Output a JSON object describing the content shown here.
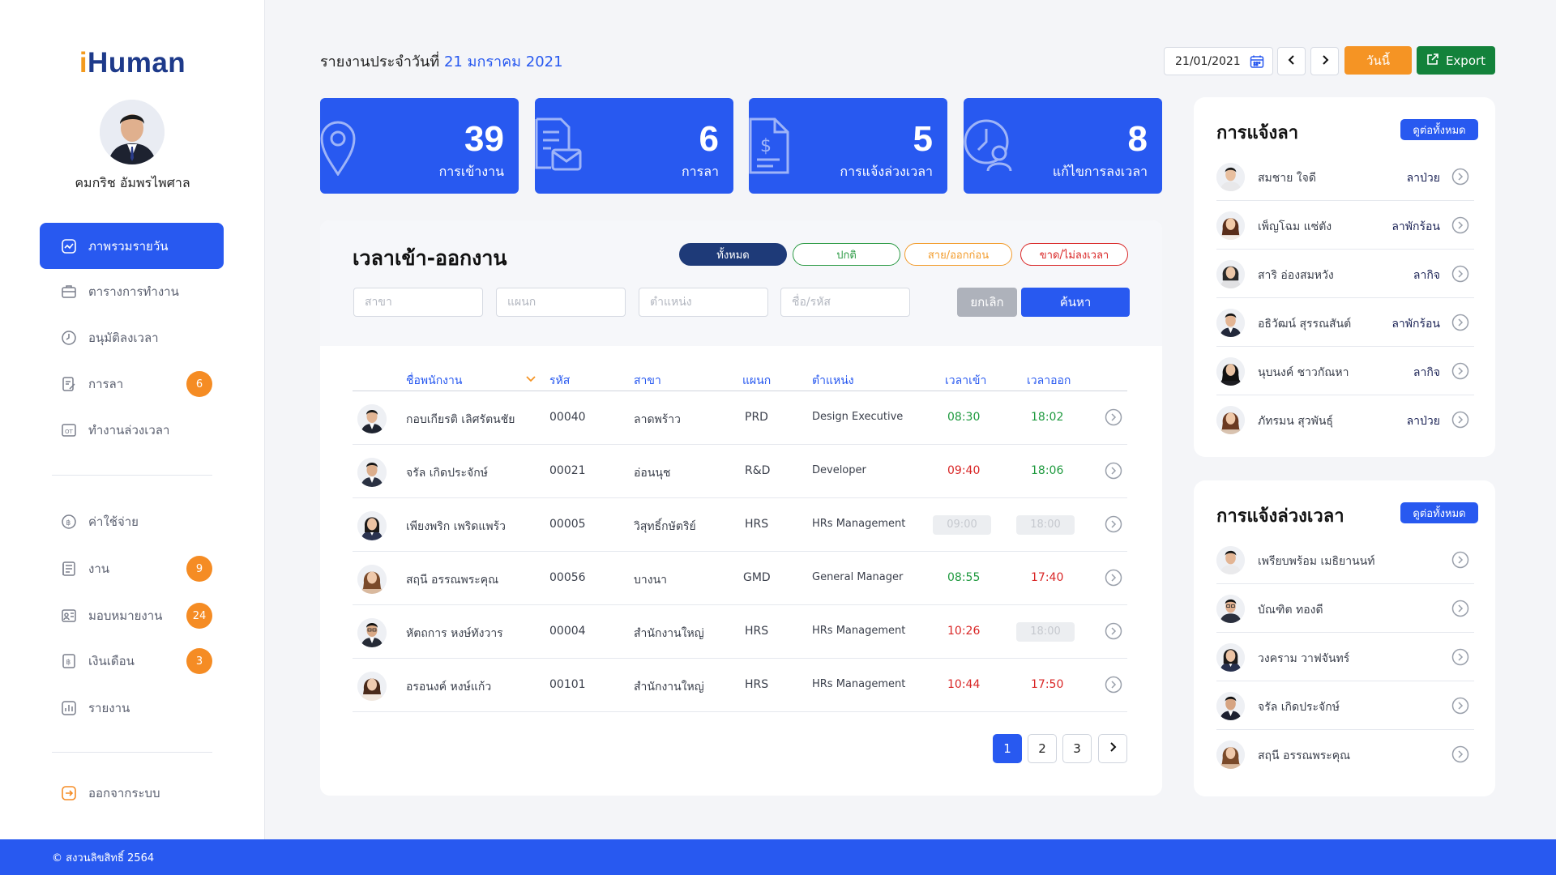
{
  "app": {
    "logo_prefix": "i",
    "logo_rest": "Human"
  },
  "user": {
    "name": "คมกริช อัมพรไพศาล"
  },
  "sidebar": {
    "items": [
      {
        "label": "ภาพรวมรายวัน",
        "icon": "chart-line-icon",
        "active": true
      },
      {
        "label": "ตารางการทำงาน",
        "icon": "briefcase-icon"
      },
      {
        "label": "อนุมัติลงเวลา",
        "icon": "clock-icon"
      },
      {
        "label": "การลา",
        "icon": "document-edit-icon",
        "badge": "6"
      },
      {
        "label": "ทำงานล่วงเวลา",
        "icon": "ot-icon"
      },
      {
        "label": "ค่าใช้จ่าย",
        "icon": "coin-icon"
      },
      {
        "label": "งาน",
        "icon": "task-list-icon",
        "badge": "9"
      },
      {
        "label": "มอบหมายงาน",
        "icon": "assign-icon",
        "badge": "24"
      },
      {
        "label": "เงินเดือน",
        "icon": "salary-icon",
        "badge": "3"
      },
      {
        "label": "รายงาน",
        "icon": "report-icon"
      },
      {
        "label": "ออกจากระบบ",
        "icon": "logout-icon"
      }
    ]
  },
  "header": {
    "title_prefix": "รายงานประจำวันที่",
    "title_date": "21 มกราคม 2021",
    "date_value": "21/01/2021",
    "today_label": "วันนี้",
    "export_label": "Export"
  },
  "stats": [
    {
      "value": "39",
      "label": "การเข้างาน",
      "icon": "location-pin-icon"
    },
    {
      "value": "6",
      "label": "การลา",
      "icon": "document-mail-icon"
    },
    {
      "value": "5",
      "label": "การแจ้งล่วงเวลา",
      "icon": "money-document-icon"
    },
    {
      "value": "8",
      "label": "แก้ไขการลงเวลา",
      "icon": "user-clock-icon"
    }
  ],
  "attendance": {
    "title": "เวลาเข้า-ออกงาน",
    "filters": [
      "ทั้งหมด",
      "ปกติ",
      "สาย/ออกก่อน",
      "ขาด/ไม่ลงเวลา"
    ],
    "active_filter": "ทั้งหมด",
    "placeholders": {
      "branch": "สาขา",
      "dept": "แผนก",
      "position": "ตำแหน่ง",
      "name": "ชื่อ/รหัส"
    },
    "cancel_label": "ยกเลิก",
    "search_label": "ค้นหา",
    "columns": [
      "ชื่อพนักงาน",
      "รหัส",
      "สาขา",
      "แผนก",
      "ตำแหน่ง",
      "เวลาเข้า",
      "เวลาออก"
    ],
    "rows": [
      {
        "name": "กอบเกียรติ เลิศรัตนชัย",
        "code": "00040",
        "branch": "ลาดพร้าว",
        "dept": "PRD",
        "position": "Design Executive",
        "in": "08:30",
        "in_status": "ok",
        "out": "18:02",
        "out_status": "ok"
      },
      {
        "name": "จรัล เกิดประจักษ์",
        "code": "00021",
        "branch": "อ่อนนุช",
        "dept": "R&D",
        "position": "Developer",
        "in": "09:40",
        "in_status": "late",
        "out": "18:06",
        "out_status": "ok"
      },
      {
        "name": "เพียงพริก เพริดแพร้ว",
        "code": "00005",
        "branch": "วิสุทธิ์กษัตริย์",
        "dept": "HRS",
        "position": "HRs Management",
        "in": "09:00",
        "in_status": "none",
        "out": "18:00",
        "out_status": "none"
      },
      {
        "name": "สฤนี อรรณพระคุณ",
        "code": "00056",
        "branch": "บางนา",
        "dept": "GMD",
        "position": "General Manager",
        "in": "08:55",
        "in_status": "ok",
        "out": "17:40",
        "out_status": "late"
      },
      {
        "name": "หัตถการ หงษ์ทังวาร",
        "code": "00004",
        "branch": "สำนักงานใหญ่",
        "dept": "HRS",
        "position": "HRs Management",
        "in": "10:26",
        "in_status": "late",
        "out": "18:00",
        "out_status": "none"
      },
      {
        "name": "อรอนงค์ หงษ์แก้ว",
        "code": "00101",
        "branch": "สำนักงานใหญ่",
        "dept": "HRS",
        "position": "HRs Management",
        "in": "10:44",
        "in_status": "late",
        "out": "17:50",
        "out_status": "late"
      }
    ],
    "pages": [
      "1",
      "2",
      "3"
    ],
    "current_page": "1"
  },
  "leave_card": {
    "title": "การแจ้งลา",
    "see_all": "ดูต่อทั้งหมด",
    "rows": [
      {
        "name": "สมชาย ใจดี",
        "type": "ลาป่วย"
      },
      {
        "name": "เพ็ญโฉม แซ่ตัง",
        "type": "ลาพักร้อน"
      },
      {
        "name": "สาริ อ่องสมหวัง",
        "type": "ลากิจ"
      },
      {
        "name": "อธิวัฒน์ สุรรณสันต์",
        "type": "ลาพักร้อน"
      },
      {
        "name": "นุบนงค์ ชาวกัณหา",
        "type": "ลากิจ"
      },
      {
        "name": "ภัทรมน สุวพันธุ์",
        "type": "ลาป่วย"
      }
    ]
  },
  "ot_card": {
    "title": "การแจ้งล่วงเวลา",
    "see_all": "ดูต่อทั้งหมด",
    "rows": [
      {
        "name": "เพรียบพร้อม เมธิยานนท์"
      },
      {
        "name": "บัณฑิต ทองดี"
      },
      {
        "name": "วงคราม วาฟจันทร์"
      },
      {
        "name": "จรัล เกิดประจักษ์"
      },
      {
        "name": "สฤนี อรรณพระคุณ"
      }
    ]
  },
  "colors": {
    "primary": "#2859f0",
    "accent": "#f59424",
    "export": "#13823b",
    "ok": "#1f9a3f",
    "late": "#d92626"
  },
  "footer": {
    "copyright": "© สงวนลิขสิทธิ์ 2564"
  }
}
